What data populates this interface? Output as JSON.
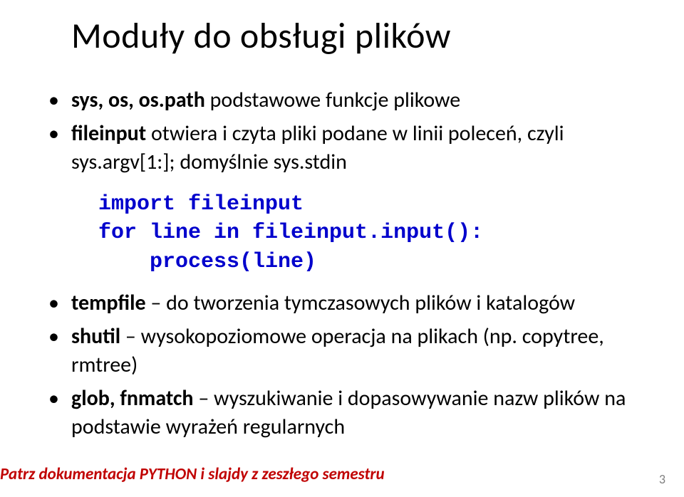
{
  "title": "Moduły do obsługi plików",
  "items": {
    "b0": {
      "bold": "sys, os, os.path",
      "rest": " podstawowe funkcje plikowe"
    },
    "b1": {
      "bold": "fileinput",
      "rest": " otwiera i czyta pliki podane w linii poleceń, czyli sys.argv[1:]; domyślnie sys.stdin"
    },
    "code": "import fileinput\nfor line in fileinput.input():\n    process(line)",
    "b2": {
      "bold": "tempfile",
      "rest": " – do tworzenia tymczasowych plików i katalogów"
    },
    "b3": {
      "bold": "shutil",
      "rest": " – wysokopoziomowe operacja na plikach (np. copytree, rmtree)"
    },
    "b4": {
      "bold": "glob, fnmatch",
      "rest": " – wyszukiwanie i dopasowywanie nazw plików na podstawie wyrażeń regularnych"
    }
  },
  "footnote": "Patrz dokumentacja PYTHON i slajdy z zeszłego semestru",
  "pagenum": "3"
}
